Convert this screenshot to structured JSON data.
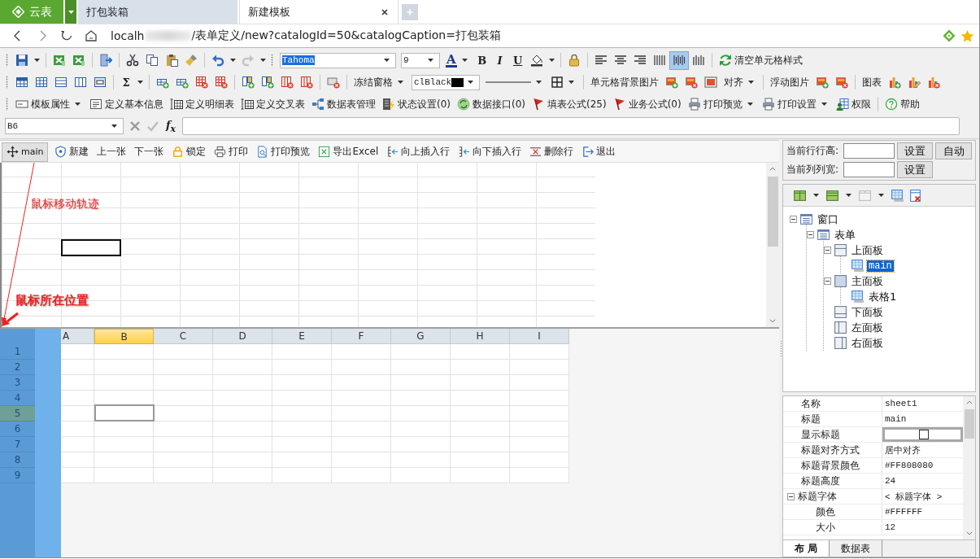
{
  "browser": {
    "app_button": "云表",
    "tabs": [
      {
        "label": "打包装箱",
        "selected": false
      },
      {
        "label": "新建模板",
        "selected": true
      }
    ],
    "address": {
      "url_start": "localh",
      "url_rest": "/表单定义/new?catalogId=50&catalogCaption=打包装箱"
    }
  },
  "format_toolbar": {
    "font": "Tahoma",
    "font_size": "9",
    "font_color": "A",
    "bold": "B",
    "italic": "I",
    "underline": "U",
    "align_buttons": [
      {
        "kind": "left",
        "selected": false
      },
      {
        "kind": "center",
        "selected": false
      },
      {
        "kind": "right",
        "selected": false
      },
      {
        "kind": "justify",
        "selected": false
      },
      {
        "kind": "distribute",
        "selected": true
      },
      {
        "kind": "spread",
        "selected": false
      }
    ],
    "clear_style": "清空单元格样式"
  },
  "sheet_toolbar": {
    "sum": "Σ",
    "freeze": "冻结窗格",
    "color_name": "clBlack",
    "cell_background": "单元格背景图片",
    "align": "对齐",
    "float_image": "浮动图片",
    "chart": "图表"
  },
  "design_toolbar": [
    {
      "label": "模板属性",
      "kind": "form",
      "dropdown": true
    },
    {
      "label": "定义基本信息",
      "kind": "info",
      "dropdown": false
    },
    {
      "label": "定义明细表",
      "kind": "detail",
      "dropdown": false
    },
    {
      "label": "定义交叉表",
      "kind": "detail",
      "dropdown": false
    },
    {
      "label": "数据表管理",
      "kind": "tables",
      "dropdown": false
    },
    {
      "label": "状态设置(0)",
      "kind": "status",
      "dropdown": false
    },
    {
      "label": "数据接口(0)",
      "kind": "interface",
      "dropdown": false
    },
    {
      "label": "填表公式(25)",
      "kind": "formula",
      "dropdown": false
    },
    {
      "label": "业务公式(0)",
      "kind": "formula",
      "dropdown": false
    },
    {
      "label": "打印预览",
      "kind": "print",
      "dropdown": true
    },
    {
      "label": "打印设置",
      "kind": "print",
      "dropdown": true
    },
    {
      "label": "权限",
      "kind": "permission",
      "dropdown": false
    },
    {
      "label": "帮助",
      "kind": "help",
      "dropdown": false
    }
  ],
  "formula_bar": {
    "cell": "B6",
    "fx": "f$_{x}$"
  },
  "form_toolbar": {
    "tab": "main",
    "buttons": [
      {
        "label": "新建",
        "kind": "new"
      },
      {
        "label": "上一张",
        "kind": "prev"
      },
      {
        "label": "下一张",
        "kind": "next"
      },
      {
        "label": "锁定",
        "kind": "lock"
      },
      {
        "label": "打印",
        "kind": "print"
      },
      {
        "label": "打印预览",
        "kind": "preview"
      },
      {
        "label": "导出Excel",
        "kind": "export"
      },
      {
        "label": "向上插入行",
        "kind": "insert-above"
      },
      {
        "label": "向下插入行",
        "kind": "insert-below"
      },
      {
        "label": "删除行",
        "kind": "delete-row"
      },
      {
        "label": "退出",
        "kind": "exit"
      }
    ]
  },
  "annotations": [
    {
      "text": "鼠标移动轨迹",
      "kind": "trail"
    },
    {
      "text": "鼠标所在位置",
      "kind": "position"
    }
  ],
  "sheet": {
    "columns": [
      {
        "label": "A",
        "selected": false
      },
      {
        "label": "B",
        "selected": true
      },
      {
        "label": "C",
        "selected": false
      },
      {
        "label": "D",
        "selected": false
      },
      {
        "label": "E",
        "selected": false
      },
      {
        "label": "F",
        "selected": false
      },
      {
        "label": "G",
        "selected": false
      },
      {
        "label": "H",
        "selected": false
      },
      {
        "label": "I",
        "selected": false
      }
    ],
    "rows": [
      {
        "label": "1",
        "selected": false
      },
      {
        "label": "2",
        "selected": false
      },
      {
        "label": "3",
        "selected": false
      },
      {
        "label": "4",
        "selected": false
      },
      {
        "label": "5",
        "selected": true
      },
      {
        "label": "6",
        "selected": false
      },
      {
        "label": "7",
        "selected": false
      },
      {
        "label": "8",
        "selected": false
      },
      {
        "label": "9",
        "selected": false
      }
    ]
  },
  "size_panel": {
    "row_height_label": "当前行行高:",
    "col_width_label": "当前列列宽:",
    "set_buttons": [
      "设置",
      "设置"
    ],
    "auto_button": "自动"
  },
  "tree": [
    {
      "label": "窗口",
      "kind": "window",
      "expanded": true,
      "selected": false,
      "children": [
        {
          "label": "表单",
          "kind": "window",
          "expanded": true,
          "selected": false,
          "children": [
            {
              "label": "上面板",
              "kind": "top-panel",
              "expanded": true,
              "selected": false,
              "children": [
                {
                  "label": "main",
                  "kind": "grid",
                  "selected": true
                }
              ]
            },
            {
              "label": "主面板",
              "kind": "main-panel",
              "expanded": true,
              "selected": false,
              "children": [
                {
                  "label": "表格1",
                  "kind": "grid",
                  "selected": false
                }
              ]
            },
            {
              "label": "下面板",
              "kind": "bottom-panel",
              "selected": false
            },
            {
              "label": "左面板",
              "kind": "left-panel",
              "selected": false
            },
            {
              "label": "右面板",
              "kind": "right-panel",
              "selected": false
            }
          ]
        }
      ]
    }
  ],
  "properties": [
    {
      "name": "名称",
      "value": "sheet1"
    },
    {
      "name": "标题",
      "value": "main"
    },
    {
      "name": "显示标题",
      "kind": "checkbox",
      "checked": false
    },
    {
      "name": "标题对齐方式",
      "value": "居中对齐"
    },
    {
      "name": "标题背景颜色",
      "value": "#FF808080"
    },
    {
      "name": "标题高度",
      "value": "24"
    },
    {
      "name": "标题字体",
      "value": "< 标题字体 >",
      "expanded": true,
      "children": [
        {
          "name": "颜色",
          "value": "#FFFFFF"
        },
        {
          "name": "大小",
          "value": "12"
        }
      ]
    }
  ],
  "bottom_tabs": [
    {
      "label": "布 局",
      "selected": true
    },
    {
      "label": "数据表",
      "selected": false
    }
  ]
}
